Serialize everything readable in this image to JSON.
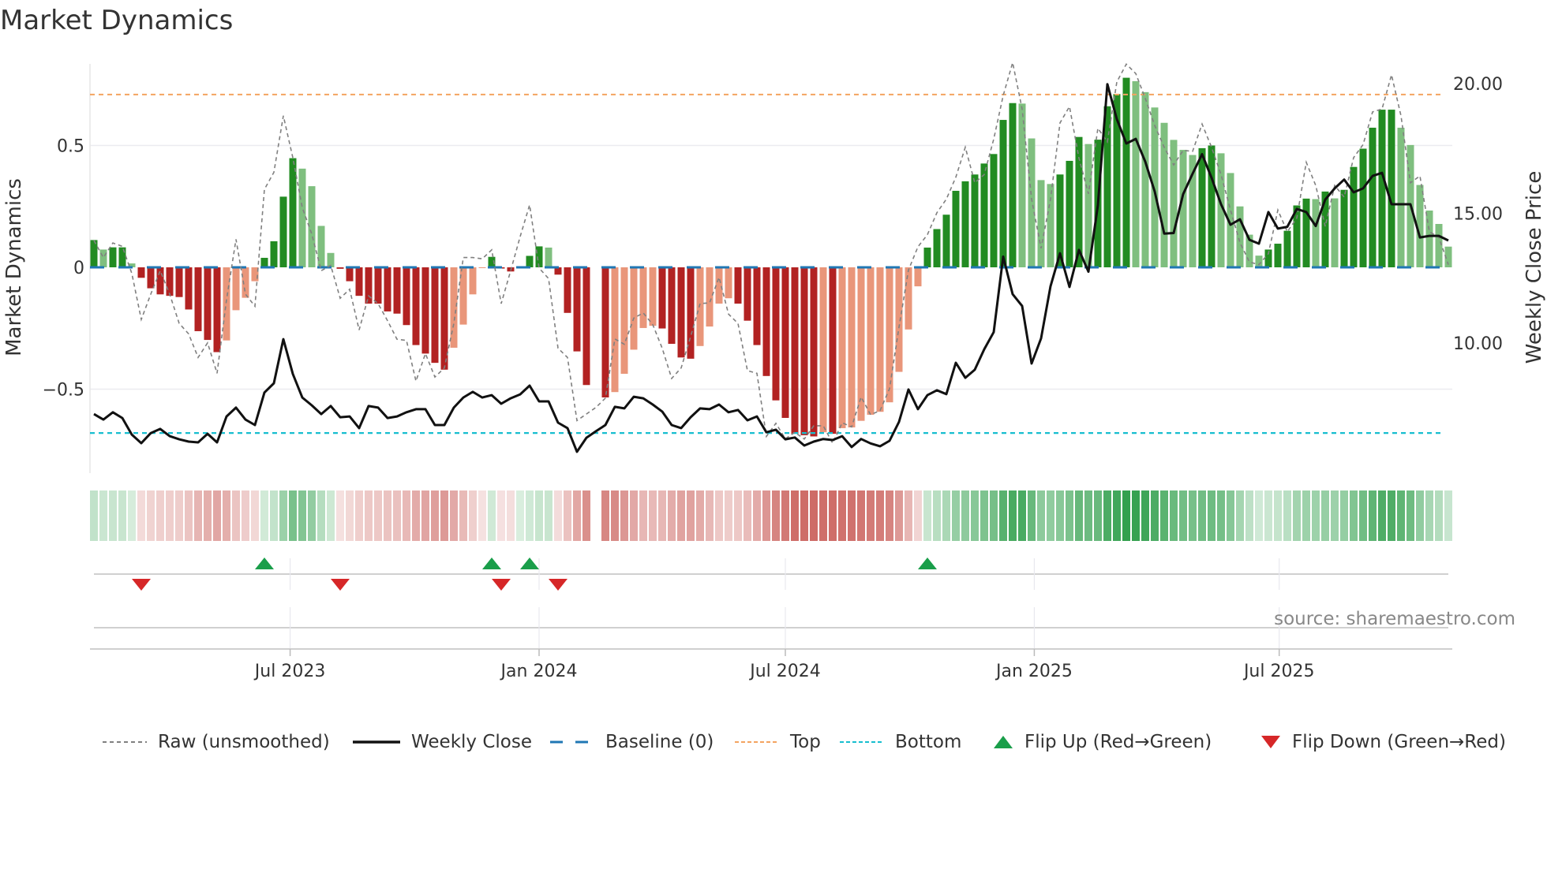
{
  "title": "Market Dynamics",
  "source": "source: sharemaestro.com",
  "colors": {
    "up_strong": "#228b22",
    "up_weak": "#7fbf7f",
    "down_strong": "#b22222",
    "down_weak": "#e9967a",
    "heat_green": "#2e9e4a",
    "heat_red": "#c85a55",
    "raw": "#808080",
    "close": "#111111",
    "baseline": "#1f77b4",
    "top": "#f4a460",
    "bottom": "#17becf",
    "flip_up": "#1a9e4a",
    "flip_down": "#d62728"
  },
  "legend": [
    {
      "key": "raw",
      "label": "Raw (unsmoothed)"
    },
    {
      "key": "close",
      "label": "Weekly Close"
    },
    {
      "key": "baseline",
      "label": "Baseline (0)"
    },
    {
      "key": "top",
      "label": "Top"
    },
    {
      "key": "bottom",
      "label": "Bottom"
    },
    {
      "key": "flip_up",
      "label": "Flip Up (Red→Green)"
    },
    {
      "key": "flip_down",
      "label": "Flip Down (Green→Red)"
    }
  ],
  "chart_data": {
    "type": "bar",
    "title": "Market Dynamics",
    "xlabel": "",
    "ylabel": "Market Dynamics",
    "y2label": "Weekly Close Price",
    "start_week": "2023-02-06",
    "interval_days": 7,
    "x_ticks": [
      {
        "date": "2023-07-01",
        "label": "Jul 2023"
      },
      {
        "date": "2024-01-01",
        "label": "Jan 2024"
      },
      {
        "date": "2024-07-01",
        "label": "Jul 2024"
      },
      {
        "date": "2025-01-01",
        "label": "Jan 2025"
      },
      {
        "date": "2025-07-01",
        "label": "Jul 2025"
      }
    ],
    "y_ticks": [
      {
        "v": 0.5,
        "label": "0.5"
      },
      {
        "v": 0,
        "label": "0"
      },
      {
        "v": -0.5,
        "label": "−0.5"
      }
    ],
    "y2_ticks": [
      {
        "v": 20,
        "label": "20.00"
      },
      {
        "v": 15,
        "label": "15.00"
      },
      {
        "v": 10,
        "label": "10.00"
      }
    ],
    "ylim": [
      -0.82,
      0.87
    ],
    "y2lim": [
      4.5,
      21.0
    ],
    "top_level": 0.709,
    "bottom_level": -0.68,
    "baseline": 0,
    "grid": true,
    "legend_position": "bottom",
    "momentum": [
      0.112,
      0.073,
      0.082,
      0.082,
      0.016,
      -0.043,
      -0.086,
      -0.111,
      -0.117,
      -0.122,
      -0.173,
      -0.262,
      -0.298,
      -0.348,
      -0.3,
      -0.176,
      -0.125,
      -0.057,
      0.039,
      0.107,
      0.29,
      0.448,
      0.405,
      0.333,
      0.17,
      0.059,
      -0.006,
      -0.057,
      -0.117,
      -0.149,
      -0.149,
      -0.181,
      -0.19,
      -0.237,
      -0.319,
      -0.354,
      -0.392,
      -0.42,
      -0.33,
      -0.235,
      -0.111,
      -0.003,
      0.043,
      -0.005,
      -0.017,
      0,
      0.047,
      0.086,
      0.081,
      -0.03,
      -0.187,
      -0.345,
      -0.483,
      null,
      -0.534,
      -0.512,
      -0.437,
      -0.338,
      -0.249,
      -0.24,
      -0.251,
      -0.314,
      -0.37,
      -0.375,
      -0.323,
      -0.243,
      -0.149,
      -0.127,
      -0.149,
      -0.219,
      -0.319,
      -0.446,
      -0.546,
      -0.618,
      -0.683,
      -0.689,
      -0.694,
      -0.677,
      -0.683,
      -0.66,
      -0.657,
      -0.63,
      -0.605,
      -0.593,
      -0.554,
      -0.429,
      -0.255,
      -0.078,
      0.081,
      0.157,
      0.216,
      0.314,
      0.353,
      0.381,
      0.426,
      0.465,
      0.605,
      0.674,
      0.672,
      0.529,
      0.358,
      0.342,
      0.381,
      0.437,
      0.535,
      0.506,
      0.524,
      0.661,
      0.711,
      0.778,
      0.764,
      0.719,
      0.656,
      0.593,
      0.523,
      0.482,
      0.461,
      0.489,
      0.5,
      0.468,
      0.387,
      0.25,
      0.134,
      0.048,
      0.073,
      0.097,
      0.15,
      0.254,
      0.282,
      0.28,
      0.311,
      0.283,
      0.318,
      0.412,
      0.487,
      0.573,
      0.647,
      0.647,
      0.573,
      0.502,
      0.338,
      0.233,
      0.178,
      0.085
    ],
    "raw": [
      0.11,
      0.04,
      0.1,
      0.086,
      -0.025,
      -0.214,
      -0.11,
      -0.014,
      -0.11,
      -0.23,
      -0.273,
      -0.37,
      -0.31,
      -0.435,
      -0.133,
      0.115,
      -0.11,
      -0.16,
      0.32,
      0.39,
      0.622,
      0.45,
      0.245,
      0.137,
      -0.014,
      0.008,
      -0.127,
      -0.09,
      -0.257,
      -0.117,
      -0.149,
      -0.219,
      -0.295,
      -0.3,
      -0.467,
      -0.354,
      -0.45,
      -0.413,
      -0.23,
      0.04,
      0.04,
      0.035,
      0.072,
      -0.149,
      -0.014,
      0.126,
      0.256,
      -0.003,
      -0.046,
      -0.332,
      -0.37,
      -0.629,
      -0.602,
      -0.575,
      -0.537,
      -0.294,
      -0.316,
      -0.208,
      -0.187,
      -0.235,
      -0.332,
      -0.456,
      -0.413,
      -0.284,
      -0.149,
      -0.146,
      -0.041,
      -0.192,
      -0.23,
      -0.424,
      -0.435,
      -0.694,
      -0.64,
      -0.704,
      -0.677,
      -0.705,
      -0.65,
      -0.65,
      -0.722,
      -0.638,
      -0.655,
      -0.532,
      -0.605,
      -0.588,
      -0.498,
      -0.246,
      -0.011,
      0.084,
      0.134,
      0.224,
      0.28,
      0.37,
      0.493,
      0.347,
      0.381,
      0.526,
      0.705,
      0.84,
      0.65,
      0.28,
      0.078,
      0.28,
      0.593,
      0.66,
      0.448,
      0.302,
      0.571,
      0.515,
      0.761,
      0.834,
      0.795,
      0.694,
      0.582,
      0.493,
      0.42,
      0.48,
      0.476,
      0.588,
      0.493,
      0.381,
      0.235,
      0.101,
      0.022,
      0.011,
      0.056,
      0.235,
      0.146,
      0.202,
      0.431,
      0.336,
      0.168,
      0.336,
      0.288,
      0.45,
      0.504,
      0.638,
      0.65,
      0.79,
      0.622,
      0.347,
      0.375,
      0.146,
      0.123,
      0.011
    ],
    "close": [
      7.26,
      7.05,
      7.33,
      7.11,
      6.47,
      6.14,
      6.53,
      6.69,
      6.41,
      6.29,
      6.2,
      6.17,
      6.5,
      6.17,
      7.17,
      7.51,
      7.05,
      6.84,
      8.09,
      8.45,
      10.15,
      8.81,
      7.9,
      7.6,
      7.26,
      7.57,
      7.14,
      7.17,
      6.72,
      7.57,
      7.51,
      7.11,
      7.17,
      7.33,
      7.45,
      7.45,
      6.84,
      6.84,
      7.51,
      7.9,
      8.12,
      7.9,
      7.99,
      7.66,
      7.87,
      8.02,
      8.36,
      7.75,
      7.75,
      6.93,
      6.72,
      5.81,
      6.35,
      6.6,
      6.84,
      7.54,
      7.48,
      7.93,
      7.87,
      7.63,
      7.36,
      6.84,
      6.72,
      7.14,
      7.48,
      7.45,
      7.63,
      7.33,
      7.42,
      7.02,
      7.17,
      6.56,
      6.66,
      6.29,
      6.36,
      6.05,
      6.2,
      6.3,
      6.26,
      6.41,
      5.99,
      6.3,
      6.13,
      6.02,
      6.23,
      6.96,
      8.21,
      7.45,
      7.99,
      8.18,
      8.03,
      9.24,
      8.66,
      8.97,
      9.76,
      10.42,
      13.33,
      11.88,
      11.43,
      9.21,
      10.18,
      12.19,
      13.46,
      12.16,
      13.59,
      12.75,
      15.32,
      19.98,
      18.63,
      17.69,
      17.87,
      16.99,
      15.84,
      14.22,
      14.24,
      15.74,
      16.53,
      17.28,
      16.37,
      15.35,
      14.56,
      14.77,
      13.98,
      13.83,
      15.05,
      14.41,
      14.48,
      15.17,
      15.05,
      14.51,
      15.53,
      15.96,
      16.3,
      15.81,
      15.96,
      16.44,
      16.56,
      15.35,
      15.35,
      15.35,
      14.07,
      14.13,
      14.13,
      13.95
    ],
    "flip_up_weeks": [
      19,
      43,
      47,
      89
    ],
    "flip_down_weeks": [
      6,
      27,
      44,
      50
    ]
  }
}
